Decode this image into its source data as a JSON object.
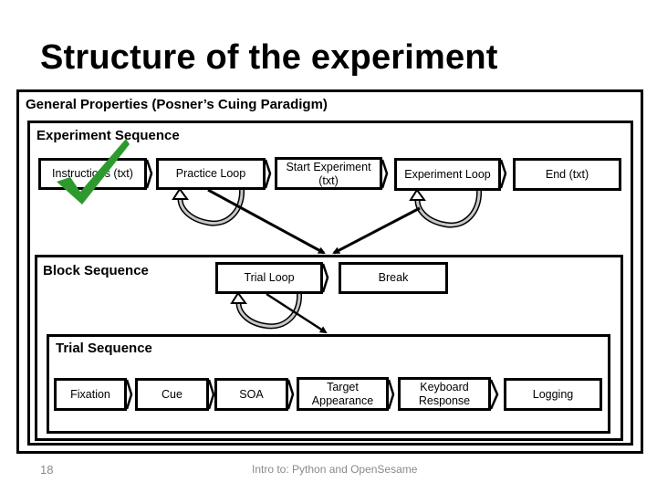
{
  "slide": {
    "title": "Structure of the experiment",
    "page_number": "18",
    "footer": "Intro to: Python and OpenSesame"
  },
  "general": {
    "label": "General Properties (Posner’s Cuing Paradigm)"
  },
  "experiment_sequence": {
    "label": "Experiment Sequence",
    "steps": [
      {
        "label": "Instructions (txt)",
        "completed": true
      },
      {
        "label": "Practice Loop"
      },
      {
        "label": "Start Experiment\n(txt)"
      },
      {
        "label": "Experiment Loop"
      },
      {
        "label": "End (txt)"
      }
    ]
  },
  "block_sequence": {
    "label": "Block Sequence",
    "steps": [
      {
        "label": "Trial Loop"
      },
      {
        "label": "Break"
      }
    ]
  },
  "trial_sequence": {
    "label": "Trial Sequence",
    "steps": [
      {
        "label": "Fixation"
      },
      {
        "label": "Cue"
      },
      {
        "label": "SOA"
      },
      {
        "label": "Target\nAppearance"
      },
      {
        "label": "Keyboard\nResponse"
      },
      {
        "label": "Logging"
      }
    ]
  },
  "colors": {
    "checkmark": "#2e9a2e",
    "loop_shade": "#c8c8c8",
    "footer_text": "#8a8a8a"
  }
}
